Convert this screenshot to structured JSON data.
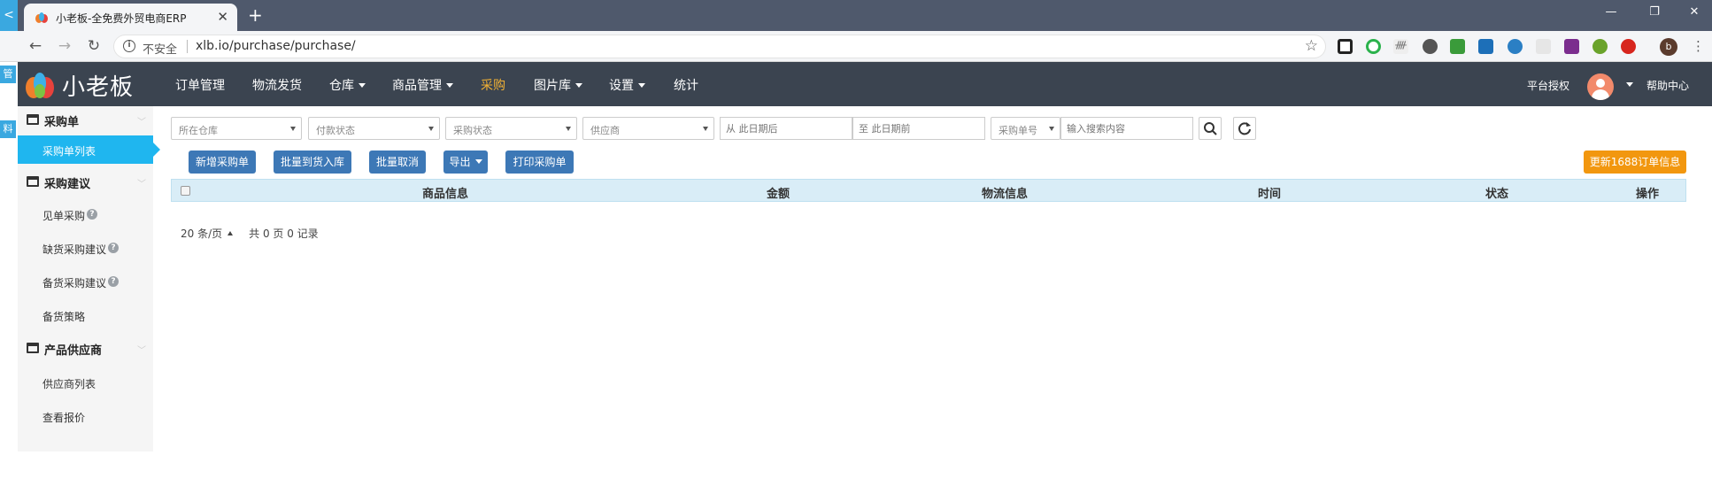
{
  "browser": {
    "tab_title": "小老板-全免费外贸电商ERP",
    "address_insecure": "不安全",
    "address_url": "xlb.io/purchase/purchase/",
    "profile_initial": "b"
  },
  "edge_tags": [
    "管",
    "料"
  ],
  "app": {
    "logo_text": "小老板",
    "menu": [
      {
        "label": "订单管理",
        "dropdown": false,
        "active": false
      },
      {
        "label": "物流发货",
        "dropdown": false,
        "active": false
      },
      {
        "label": "仓库",
        "dropdown": true,
        "active": false
      },
      {
        "label": "商品管理",
        "dropdown": true,
        "active": false
      },
      {
        "label": "采购",
        "dropdown": false,
        "active": true
      },
      {
        "label": "图片库",
        "dropdown": true,
        "active": false
      },
      {
        "label": "设置",
        "dropdown": true,
        "active": false
      },
      {
        "label": "统计",
        "dropdown": false,
        "active": false
      }
    ],
    "right": {
      "auth": "平台授权",
      "help": "帮助中心"
    }
  },
  "sidebar": {
    "groups": [
      {
        "label": "采购单",
        "items": [
          {
            "label": "采购单列表",
            "active": true,
            "help": false
          }
        ]
      },
      {
        "label": "采购建议",
        "items": [
          {
            "label": "见单采购",
            "active": false,
            "help": true
          },
          {
            "label": "缺货采购建议",
            "active": false,
            "help": true
          },
          {
            "label": "备货采购建议",
            "active": false,
            "help": true
          },
          {
            "label": "备货策略",
            "active": false,
            "help": false
          }
        ]
      },
      {
        "label": "产品供应商",
        "items": [
          {
            "label": "供应商列表",
            "active": false,
            "help": false
          },
          {
            "label": "查看报价",
            "active": false,
            "help": false
          }
        ]
      }
    ]
  },
  "filters": {
    "warehouse": "所在仓库",
    "payment_status": "付款状态",
    "purchase_status": "采购状态",
    "supplier": "供应商",
    "date_from_placeholder": "从 此日期后",
    "date_to_placeholder": "至 此日期前",
    "search_field": "采购单号",
    "search_placeholder": "输入搜索内容"
  },
  "actions": {
    "new_order": "新增采购单",
    "batch_receive": "批量到货入库",
    "batch_cancel": "批量取消",
    "export": "导出",
    "print": "打印采购单",
    "update_1688": "更新1688订单信息"
  },
  "table": {
    "columns": [
      "商品信息",
      "金额",
      "物流信息",
      "时间",
      "状态",
      "操作"
    ]
  },
  "pager": {
    "page_size": "20 条/页",
    "summary": "共 0 页 0 记录"
  },
  "colors": {
    "appbar": "#3b4450",
    "menu_active": "#f2b134",
    "sidebar_active": "#1fb6ef",
    "btn_primary": "#3d78b6",
    "btn_orange": "#f2970f",
    "table_header": "#d9edf7"
  }
}
